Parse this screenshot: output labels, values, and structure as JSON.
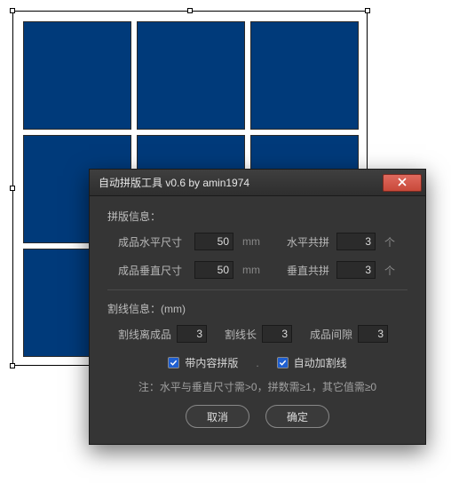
{
  "canvas": {
    "grid_rows": 3,
    "grid_cols": 3,
    "tile_color": "#003a7a"
  },
  "dialog": {
    "title": "自动拼版工具 v0.6   by amin1974",
    "section1": {
      "label": "拼版信息：",
      "row1": {
        "label": "成品水平尺寸",
        "value": "50",
        "unit": "mm",
        "label2": "水平共拼",
        "value2": "3",
        "unit2": "个"
      },
      "row2": {
        "label": "成品垂直尺寸",
        "value": "50",
        "unit": "mm",
        "label2": "垂直共拼",
        "value2": "3",
        "unit2": "个"
      }
    },
    "section2": {
      "label": "割线信息：(mm)",
      "f1": {
        "label": "割线离成品",
        "value": "3"
      },
      "f2": {
        "label": "割线长",
        "value": "3"
      },
      "f3": {
        "label": "成品间隙",
        "value": "3"
      }
    },
    "checks": {
      "c1": {
        "label": "带内容拼版",
        "checked": true
      },
      "c2": {
        "label": "自动加割线",
        "checked": true
      },
      "sep": "."
    },
    "note": "注：水平与垂直尺寸需>0，拼数需≥1，其它值需≥0",
    "buttons": {
      "cancel": "取消",
      "ok": "确定"
    }
  }
}
